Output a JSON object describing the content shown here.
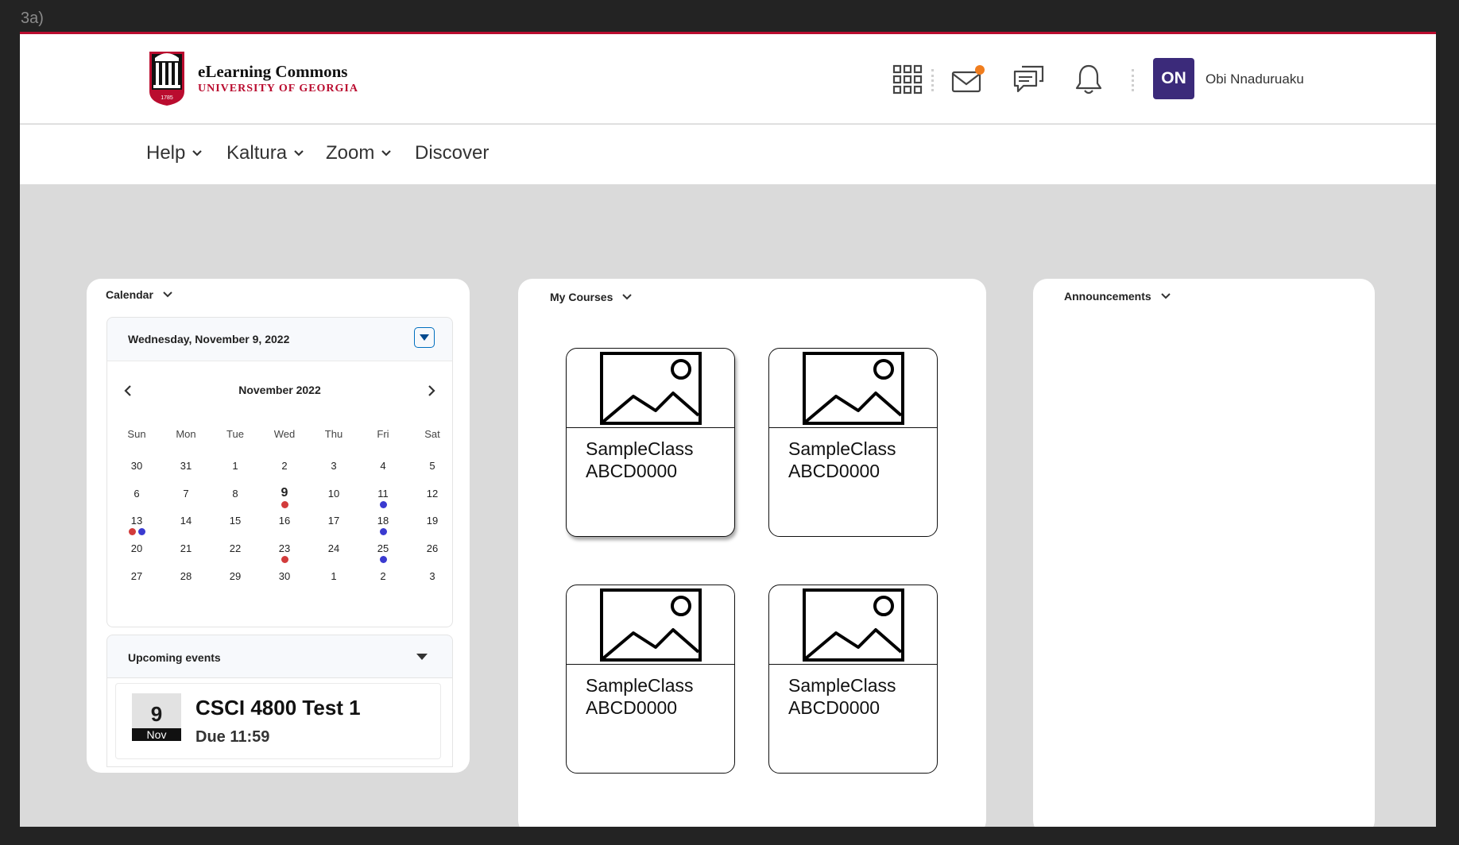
{
  "frame_label": "3a)",
  "header": {
    "logo_title": "eLearning Commons",
    "logo_subtitle": "UNIVERSITY OF GEORGIA",
    "logo_seal_text": "1785",
    "icons": [
      "apps-grid-icon",
      "mail-icon",
      "chat-icon",
      "bell-icon"
    ],
    "avatar_initials": "ON",
    "user_name": "Obi Nnaduruaku",
    "accent_color": "#ba0c2f",
    "avatar_color": "#3b2a7a",
    "notification_color": "#f07d1e"
  },
  "nav": {
    "items": [
      {
        "label": "Help",
        "has_menu": true
      },
      {
        "label": "Kaltura",
        "has_menu": true
      },
      {
        "label": "Zoom",
        "has_menu": true
      },
      {
        "label": "Discover",
        "has_menu": false
      }
    ]
  },
  "calendar": {
    "title": "Calendar",
    "selected_date": "Wednesday, November 9, 2022",
    "month_label": "November 2022",
    "weekdays": [
      "Sun",
      "Mon",
      "Tue",
      "Wed",
      "Thu",
      "Fri",
      "Sat"
    ],
    "weeks": [
      [
        "30",
        "31",
        "1",
        "2",
        "3",
        "4",
        "5"
      ],
      [
        "6",
        "7",
        "8",
        "9",
        "10",
        "11",
        "12"
      ],
      [
        "13",
        "14",
        "15",
        "16",
        "17",
        "18",
        "19"
      ],
      [
        "20",
        "21",
        "22",
        "23",
        "24",
        "25",
        "26"
      ],
      [
        "27",
        "28",
        "29",
        "30",
        "1",
        "2",
        "3"
      ]
    ],
    "today": "9",
    "event_dots": [
      {
        "week": 1,
        "day": 3,
        "dots": [
          "red"
        ]
      },
      {
        "week": 1,
        "day": 5,
        "dots": [
          "blue"
        ]
      },
      {
        "week": 2,
        "day": 0,
        "dots": [
          "red",
          "blue"
        ]
      },
      {
        "week": 2,
        "day": 5,
        "dots": [
          "blue"
        ]
      },
      {
        "week": 3,
        "day": 3,
        "dots": [
          "red"
        ]
      },
      {
        "week": 3,
        "day": 5,
        "dots": [
          "blue"
        ]
      }
    ],
    "upcoming_title": "Upcoming events",
    "event": {
      "day": "9",
      "month": "Nov",
      "title": "CSCI 4800 Test 1",
      "due": "Due 11:59"
    }
  },
  "courses": {
    "title": "My Courses",
    "items": [
      {
        "name": "SampleClass",
        "code": "ABCD0000"
      },
      {
        "name": "SampleClass",
        "code": "ABCD0000"
      },
      {
        "name": "SampleClass",
        "code": "ABCD0000"
      },
      {
        "name": "SampleClass",
        "code": "ABCD0000"
      }
    ]
  },
  "announcements": {
    "title": "Announcements"
  }
}
